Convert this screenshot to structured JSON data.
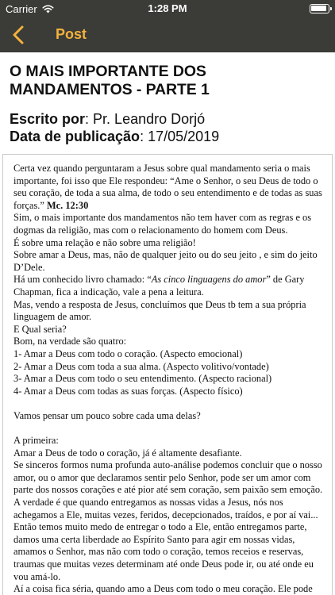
{
  "status_bar": {
    "carrier": "Carrier",
    "time": "1:28 PM",
    "wifi_icon": "wifi-icon",
    "battery_icon": "battery-icon"
  },
  "nav": {
    "back_icon": "chevron-left-icon",
    "title": "Post",
    "accent_color": "#f3b23b",
    "bar_color": "#3b3b38"
  },
  "post": {
    "title": "O MAIS IMPORTANTE DOS MANDAMENTOS - PARTE 1",
    "author_label": "Escrito por",
    "author": "Pr. Leandro Dorjó",
    "date_label": "Data de publicação",
    "date": "17/05/2019"
  },
  "article": {
    "l1": "Certa vez quando perguntaram a Jesus sobre qual mandamento seria o mais",
    "l2": "importante, foi isso que Ele respondeu: “Ame o Senhor, o seu Deus de todo o",
    "l3": "seu coração, de toda a sua alma, de todo o seu entendimento e de todas as suas",
    "l4a": "forças.” ",
    "l4b": "Mc. 12:30",
    "l5": "Sim, o mais importante dos mandamentos não tem haver com as regras e os",
    "l6": "dogmas da religião, mas com o relacionamento do homem com Deus.",
    "l7": "É sobre uma relação e não sobre uma religião!",
    "l8": "Sobre amar a Deus, mas, não de qualquer jeito ou do seu jeito , e sim do jeito",
    "l9": "D’Dele.",
    "l10a": "Há um conhecido livro chamado: “",
    "l10b": "As cinco linguagens do amor",
    "l10c": "” de Gary",
    "l11": "Chapman, fica a indicação, vale a pena a leitura.",
    "l12": "Mas, vendo a resposta de Jesus, concluímos que Deus tb tem a sua própria",
    "l13": "linguagem de amor.",
    "l14": "E Qual seria?",
    "l15": "Bom, na verdade são quatro:",
    "l16": "1- Amar a Deus com todo o coração. (Aspecto emocional)",
    "l17": "2- Amar a Deus com toda a sua alma. (Aspecto volitivo/vontade)",
    "l18": "3- Amar a Deus com todo o seu entendimento. (Aspecto racional)",
    "l19": "4- Amar a Deus com todas as suas forças. (Aspecto físico)",
    "l20": "Vamos pensar um pouco sobre cada uma delas?",
    "l21": "A primeira:",
    "l22": "Amar a Deus de todo o coração, já é altamente desafiante.",
    "l23": "Se sinceros formos numa profunda auto-análise podemos concluir que o nosso",
    "l24": "amor, ou o amor que declaramos sentir pelo Senhor, pode ser um amor com",
    "l25": "parte dos nossos corações e até pior até sem coração, sem paixão sem emoção.",
    "l26": "A verdade é que quando entregamos as nossas vidas a Jesus, nós nos",
    "l27": "achegamos a Ele, muitas vezes, feridos, decepcionados, traídos, e por aí vai...",
    "l28": "Então temos muito medo de entregar o todo a Ele, então entregamos parte,",
    "l29": "damos uma certa liberdade ao Espírito Santo para agir em nossas vidas,",
    "l30": "amamos o Senhor, mas não com todo o coração, temos receios e reservas,",
    "l31": "traumas que muitas vezes determinam até onde Deus pode ir, ou até onde eu",
    "l32": "vou amá-lo.",
    "l33": "Aí a coisa fica séria, quando amo a Deus com todo o meu coração. Ele pode"
  }
}
